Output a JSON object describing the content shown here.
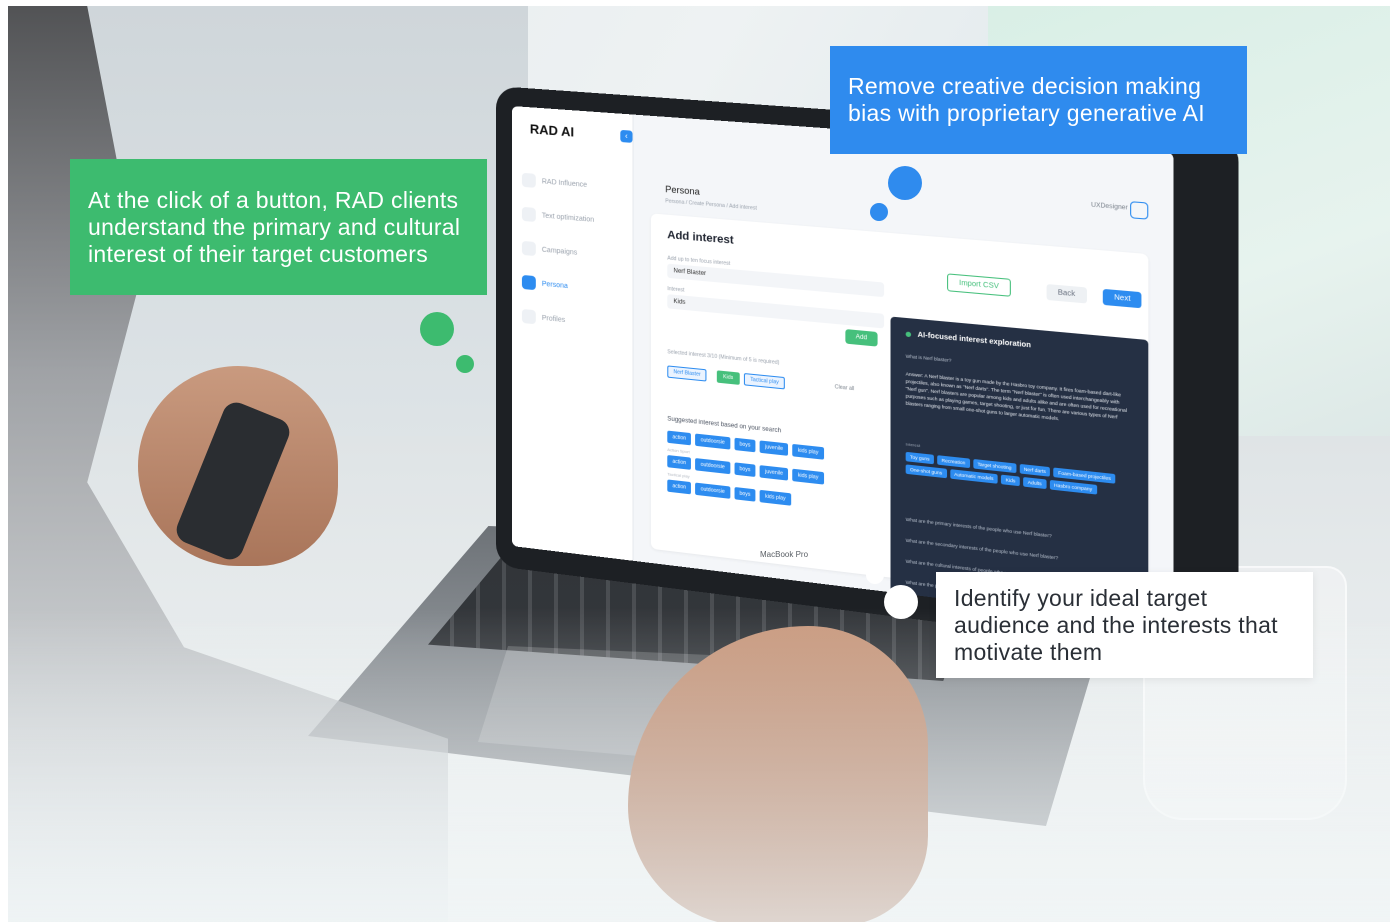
{
  "callouts": {
    "green": "At the click of a button, RAD clients understand the primary and cultural interest of their target customers",
    "blue": "Remove creative decision making bias with proprietary generative AI",
    "white": "Identify your ideal target audience and the interests that motivate them"
  },
  "colors": {
    "green": "#3dbb6f",
    "blue": "#2f8bee",
    "white": "#ffffff"
  },
  "app": {
    "logo": "RAD AI",
    "sidebar": {
      "items": [
        {
          "label": "RAD Influence"
        },
        {
          "label": "Text optimization"
        },
        {
          "label": "Campaigns"
        },
        {
          "label": "Persona"
        },
        {
          "label": "Profiles"
        }
      ]
    },
    "user": "UXDesigner",
    "page_title": "Persona",
    "breadcrumb": "Persona / Create Persona / Add interest",
    "card_title": "Add interest",
    "buttons": {
      "import": "Import CSV",
      "back": "Back",
      "next": "Next",
      "add": "Add"
    },
    "field_label": "Add up to ten focus interest",
    "field_value": "Nerf Blaster",
    "interest_label": "Interest",
    "interest_value": "Kids",
    "selected_label": "Selected interest 3/10 (Minimum of 5 is required)",
    "selected_tags": [
      "Nerf Blaster",
      "Kids",
      "Tactical play"
    ],
    "clear_all": "Clear all",
    "suggested_title": "Suggested interest based on your search",
    "chip_rows": [
      [
        "action",
        "outdoorsie",
        "boys",
        "juvenile",
        "kids play"
      ],
      [
        "action",
        "outdoorsie",
        "boys",
        "juvenile",
        "kids play"
      ],
      [
        "action",
        "outdoorsie",
        "boys",
        "kids play"
      ]
    ],
    "chip_row_labels": [
      "Nerf Blaster",
      "Action Sport",
      "Tactical play"
    ],
    "ai": {
      "title": "AI-focused interest exploration",
      "question1": "What is Nerf blaster?",
      "answer": "Answer: A Nerf blaster is a toy gun made by the Hasbro toy company. It fires foam-based dart-like projectiles, also known as \"Nerf darts\". The term \"Nerf blaster\" is often used interchangeably with \"Nerf gun\". Nerf blasters are popular among kids and adults alike and are often used for recreational purposes such as playing games, target shooting, or just for fun. There are various types of Nerf blasters ranging from small one-shot guns to larger automatic models.",
      "interests_label": "Interest",
      "chips": [
        "Toy guns",
        "Recreation",
        "Target shooting",
        "Nerf darts",
        "Foam-based projectiles",
        "One-shot guns",
        "Automatic models",
        "Kids",
        "Adults",
        "Hasbro company"
      ],
      "questions": [
        "What are the primary interests of the people who use Nerf blaster?",
        "What are the secondary interests of the people who use Nerf blaster?",
        "What are the cultural interests of people who use Nerf blaster?",
        "What are the primary customer segments of people"
      ]
    },
    "device_label": "MacBook Pro"
  }
}
